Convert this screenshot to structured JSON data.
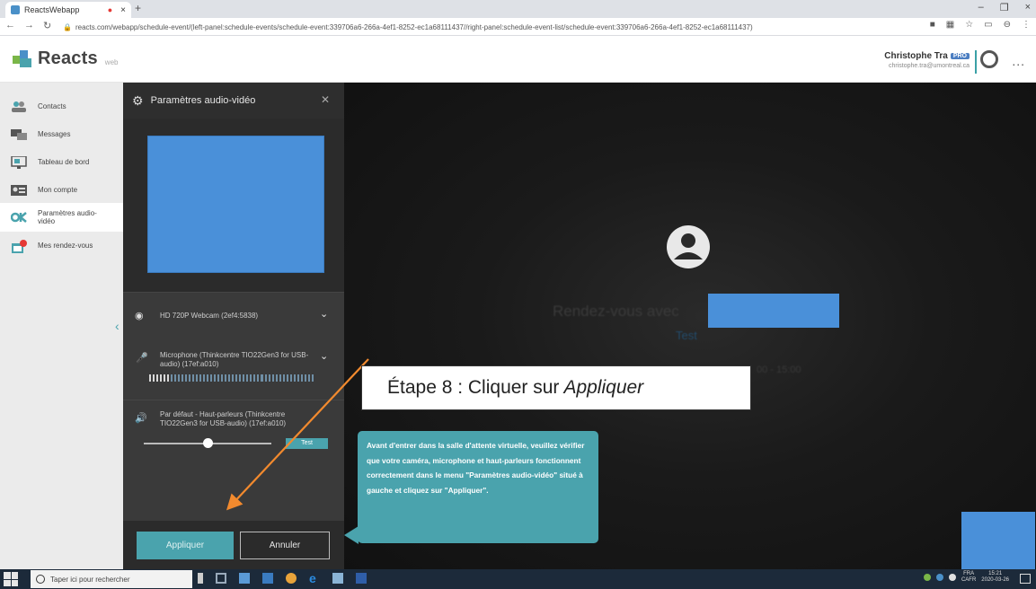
{
  "browser": {
    "tab_title": "ReactsWebapp",
    "new_tab": "+",
    "url": "reacts.com/webapp/schedule-event/(left-panel:schedule-events/schedule-event:339706a6-266a-4ef1-8252-ec1a68111437//right-panel:schedule-event-list/schedule-event:339706a6-266a-4ef1-8252-ec1a68111437)"
  },
  "header": {
    "logo_text": "Reacts",
    "logo_sub": "web",
    "user_name": "Christophe Tra",
    "badge": "PRO",
    "user_email": "christophe.tra@umontreal.ca",
    "more": "..."
  },
  "sidebar": {
    "items": [
      {
        "label": "Contacts"
      },
      {
        "label": "Messages"
      },
      {
        "label": "Tableau de bord"
      },
      {
        "label": "Mon compte"
      },
      {
        "label": "Paramètres audio-vidéo"
      },
      {
        "label": "Mes rendez-vous"
      }
    ],
    "collapse_glyph": "‹"
  },
  "panel": {
    "title": "Paramètres audio-vidéo",
    "camera": "HD 720P Webcam (2ef4:5838)",
    "microphone": "Microphone (Thinkcentre TIO22Gen3 for USB-audio) (17ef:a010)",
    "speaker": "Par défaut - Haut-parleurs (Thinkcentre TIO22Gen3 for USB-audio) (17ef:a010)",
    "test_label": "Test",
    "apply_label": "Appliquer",
    "cancel_label": "Annuler",
    "mic_level": 0.12,
    "volume_level": 0.5
  },
  "video": {
    "rdv_text": "Rendez-vous avec",
    "test_text": "Test",
    "time_text": "00 - 15:00"
  },
  "annotation": {
    "step": "Étape 8 : Cliquer sur",
    "step_em": "Appliquer"
  },
  "tooltip": {
    "text": "Avant d'entrer dans la salle d'attente virtuelle, veuillez vérifier que votre caméra, microphone et haut-parleurs fonctionnent correctement dans le menu \"Paramètres audio-vidéo\" situé à gauche et cliquez sur \"Appliquer\"."
  },
  "taskbar": {
    "search_placeholder": "Taper ici pour rechercher",
    "lang": "FRA",
    "layout": "CAFR",
    "time": "15:21",
    "date": "2020-03-26"
  },
  "colors": {
    "accent": "#4aa3ad",
    "redacted": "#4a90d9"
  }
}
